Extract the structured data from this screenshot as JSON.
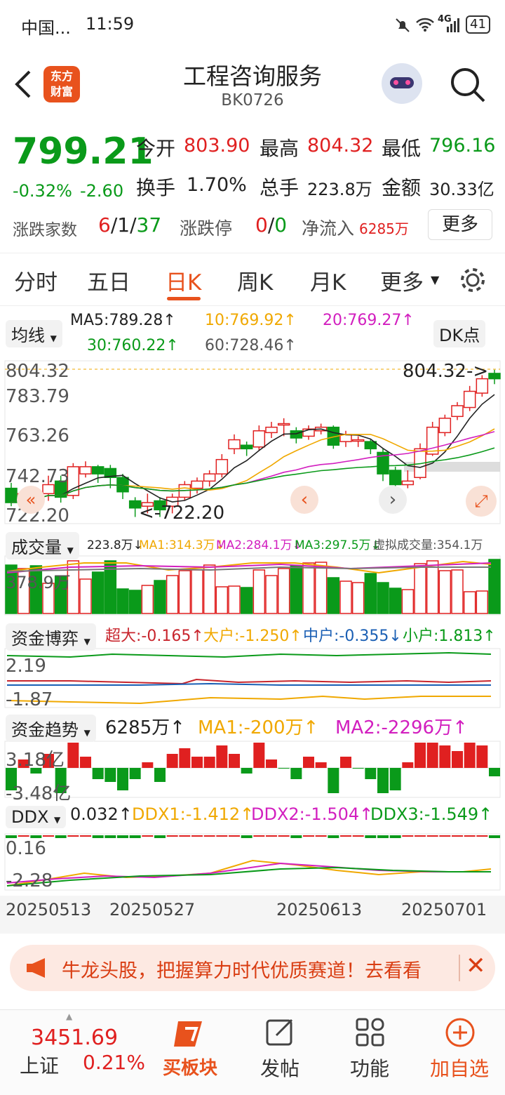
{
  "status": {
    "carrier": "中国...",
    "time": "11:59",
    "network": "4G",
    "battery": "41"
  },
  "nav": {
    "title": "工程咨询服务",
    "code": "BK0726",
    "logo_text": "东方\n财富"
  },
  "quote": {
    "price": "799.21",
    "pct": "-0.32%",
    "chg": "-2.60",
    "open_label": "今开",
    "open": "803.90",
    "high_label": "最高",
    "high": "804.32",
    "low_label": "最低",
    "low": "796.16",
    "turnover_label": "换手",
    "turnover": "1.70%",
    "volume_label": "总手",
    "volume": "223.8万",
    "amount_label": "金额",
    "amount": "30.33亿",
    "updown_label": "涨跌家数",
    "up": "6",
    "flat": "1",
    "down": "37",
    "limit_label": "涨跌停",
    "limit_up": "0",
    "limit_down": "0",
    "inflow_label": "净流入",
    "inflow": "6285万",
    "more_button": "更多"
  },
  "tabs": [
    "分时",
    "五日",
    "日K",
    "周K",
    "月K",
    "更多"
  ],
  "chart": {
    "ma_selector": "均线",
    "ma5": "MA5:789.28↑",
    "ma10": "10:769.92↑",
    "ma20": "20:769.27↑",
    "ma30": "30:760.22↑",
    "ma60": "60:728.46↑",
    "dk_button": "DK点",
    "price_ticks": [
      "804.32",
      "783.79",
      "763.26",
      "742.73",
      "722.20"
    ],
    "high_marker": "804.32->",
    "low_marker": "<-722.20",
    "vol_selector": "成交量",
    "vol_value": "223.8万↓",
    "vol_ma1": "MA1:314.3万↓",
    "vol_ma2": "MA2:284.1万↓",
    "vol_ma3": "MA3:297.5万↓",
    "vol_virtual": "虚拟成交量:354.1万",
    "vol_tick": "378.9万",
    "fund_selector": "资金博弈",
    "fund_super": "超大:-0.165↑",
    "fund_big": "大户:-1.250↑",
    "fund_mid": "中户:-0.355↓",
    "fund_small": "小户:1.813↑",
    "fund_ticks": [
      "2.19",
      "-1.87"
    ],
    "trend_selector": "资金趋势",
    "trend_value": "6285万↑",
    "trend_ma1": "MA1:-200万↑",
    "trend_ma2": "MA2:-2296万↑",
    "trend_ticks": [
      "3.18亿",
      "-3.48亿"
    ],
    "ddx_selector": "DDX",
    "ddx_value": "0.032↑",
    "ddx1": "DDX1:-1.412↑",
    "ddx2": "DDX2:-1.504↑",
    "ddx3": "DDX3:-1.549↑",
    "ddx_ticks": [
      "0.16",
      "-2.28"
    ],
    "dates": [
      "20250513",
      "20250527",
      "20250613",
      "20250701"
    ]
  },
  "chart_data": {
    "type": "candlestick",
    "candles": [
      [
        738,
        730,
        741,
        728
      ],
      [
        732,
        735,
        738,
        729
      ],
      [
        733,
        731,
        736,
        728
      ],
      [
        735,
        740,
        745,
        731
      ],
      [
        742,
        733,
        745,
        730
      ],
      [
        734,
        750,
        752,
        732
      ],
      [
        746,
        750,
        753,
        744
      ],
      [
        750,
        746,
        751,
        741
      ],
      [
        749,
        744,
        751,
        738
      ],
      [
        744,
        736,
        746,
        732
      ],
      [
        731,
        727,
        733,
        722
      ],
      [
        728,
        730,
        735,
        724
      ],
      [
        731,
        726,
        733,
        722
      ],
      [
        728,
        733,
        735,
        724
      ],
      [
        733,
        740,
        742,
        731
      ],
      [
        738,
        742,
        744,
        735
      ],
      [
        742,
        746,
        748,
        739
      ],
      [
        746,
        754,
        757,
        744
      ],
      [
        760,
        765,
        768,
        757
      ],
      [
        762,
        760,
        764,
        756
      ],
      [
        761,
        770,
        773,
        759
      ],
      [
        769,
        772,
        775,
        766
      ],
      [
        774,
        774,
        777,
        767
      ],
      [
        770,
        766,
        772,
        763
      ],
      [
        767,
        771,
        773,
        765
      ],
      [
        770,
        772,
        774,
        768
      ],
      [
        772,
        762,
        773,
        760
      ],
      [
        764,
        768,
        770,
        761
      ],
      [
        765,
        765,
        767,
        761
      ],
      [
        764,
        760,
        765,
        757
      ],
      [
        758,
        746,
        760,
        742
      ],
      [
        748,
        740,
        750,
        737
      ],
      [
        740,
        742,
        748,
        738
      ],
      [
        744,
        760,
        763,
        743
      ],
      [
        757,
        772,
        775,
        756
      ],
      [
        769,
        777,
        779,
        767
      ],
      [
        778,
        784,
        786,
        776
      ],
      [
        783,
        792,
        795,
        781
      ],
      [
        791,
        799,
        801,
        789
      ],
      [
        802,
        799,
        804,
        796
      ]
    ],
    "ylim": [
      722.2,
      804.32
    ]
  },
  "banner": {
    "text": "牛龙头股，把握算力时代优质赛道！去看看"
  },
  "bottom": {
    "index_value": "3451.69",
    "index_name": "上证",
    "index_pct": "0.21%",
    "buy": "买板块",
    "post": "发帖",
    "func": "功能",
    "add": "加自选"
  }
}
